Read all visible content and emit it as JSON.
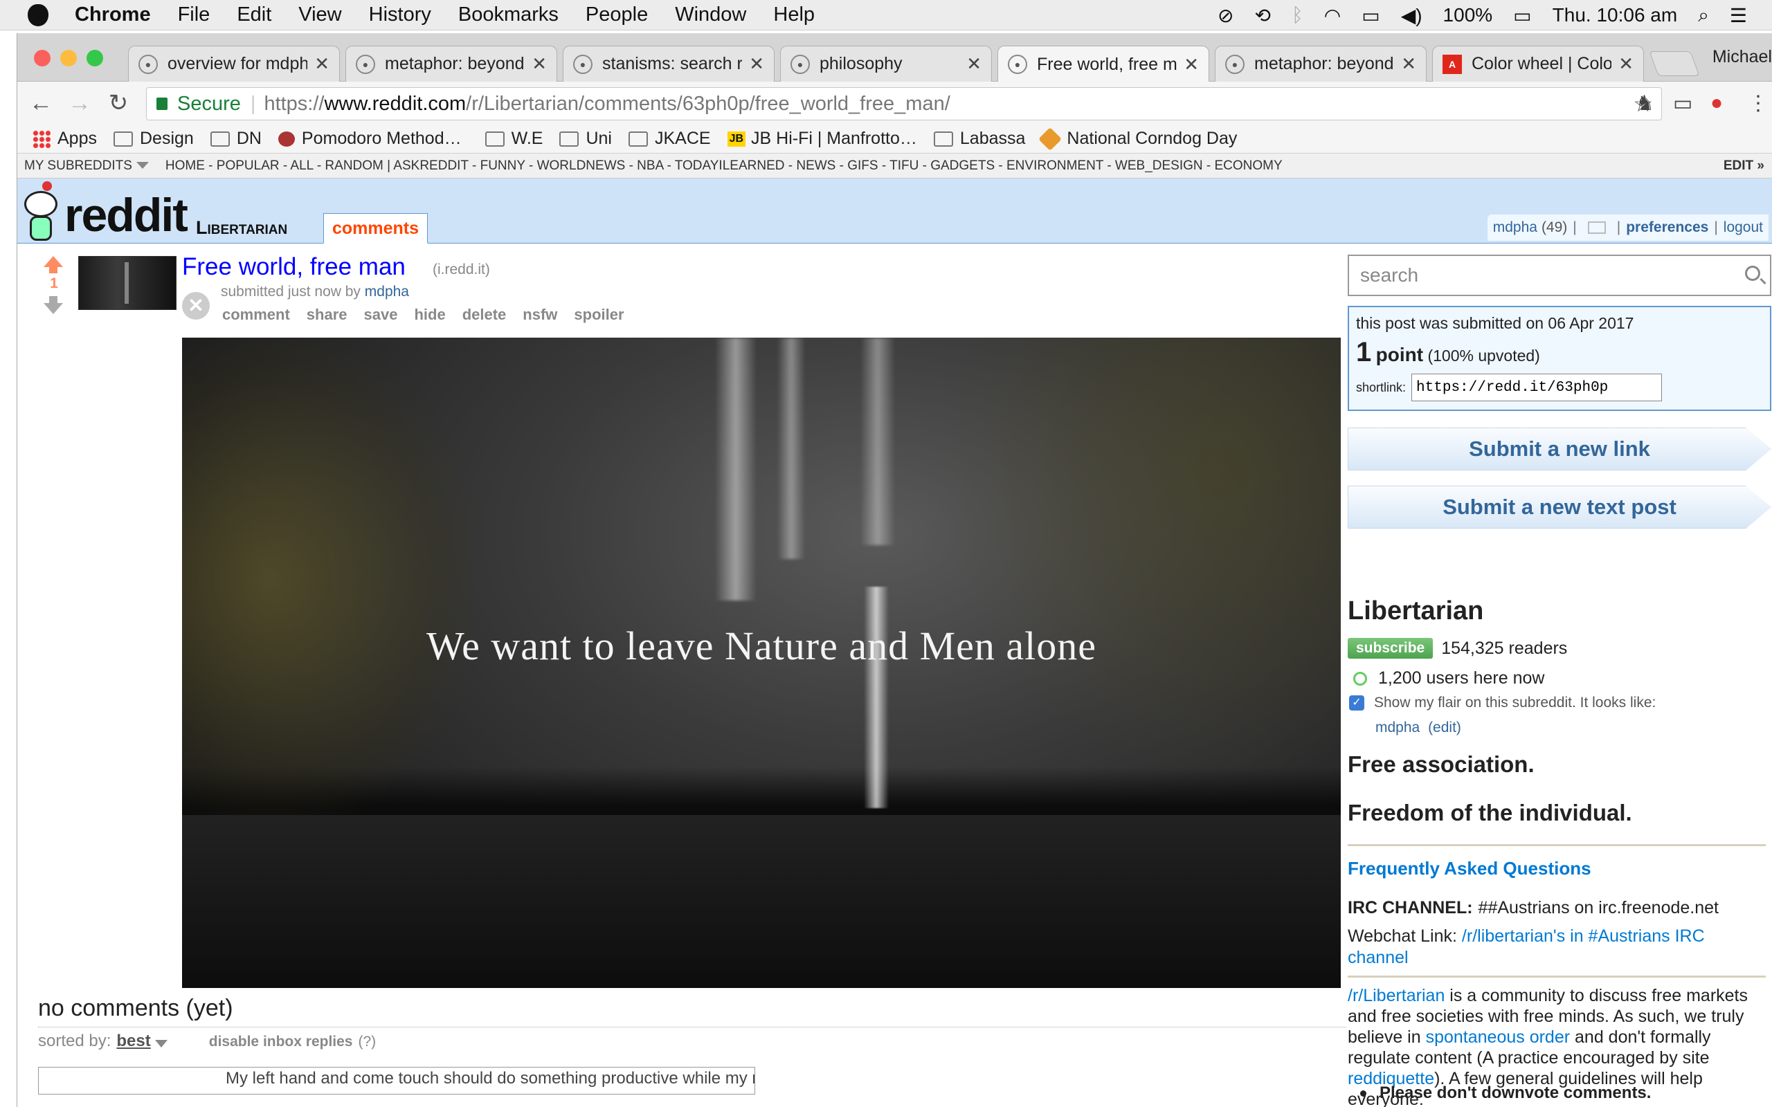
{
  "menubar": {
    "app": "Chrome",
    "items": [
      "File",
      "Edit",
      "View",
      "History",
      "Bookmarks",
      "People",
      "Window",
      "Help"
    ],
    "battery": "100%",
    "clock": "Thu. 10:06 am"
  },
  "tabs": [
    {
      "title": "overview for mdph",
      "active": false
    },
    {
      "title": "metaphor: beyond",
      "active": false
    },
    {
      "title": "stanisms: search r",
      "active": false
    },
    {
      "title": "philosophy",
      "active": false
    },
    {
      "title": "Free world, free m",
      "active": true
    },
    {
      "title": "metaphor: beyond",
      "active": false
    },
    {
      "title": "Color wheel | Colo",
      "active": false
    }
  ],
  "profile_name": "Michael",
  "omnibox": {
    "secure_label": "Secure",
    "url_scheme": "https://",
    "url_host": "www.reddit.com",
    "url_path": "/r/Libertarian/comments/63ph0p/free_world_free_man/"
  },
  "bookmarks": [
    "Apps",
    "Design",
    "DN",
    "Pomodoro Method…",
    "W.E",
    "Uni",
    "JKACE",
    "JB Hi-Fi | Manfrotto…",
    "Labassa",
    "National Corndog Day"
  ],
  "srbar": {
    "my_subreddits": "MY SUBREDDITS",
    "links": "HOME - POPULAR - ALL - RANDOM  |  ASKREDDIT - FUNNY - WORLDNEWS - NBA - TODAYILEARNED - NEWS - GIFS - TIFU - GADGETS - ENVIRONMENT - WEB_DESIGN - ECONOMY",
    "edit": "EDIT »"
  },
  "header": {
    "logo": "reddit",
    "subreddit": "Libertarian",
    "tab": "comments",
    "user": "mdpha",
    "karma": "(49)",
    "preferences": "preferences",
    "logout": "logout"
  },
  "post": {
    "score": "1",
    "title": "Free world, free man",
    "domain": "(i.redd.it)",
    "submitted": "submitted just now by",
    "author": "mdpha",
    "buttons": [
      "comment",
      "share",
      "save",
      "hide",
      "delete",
      "nsfw",
      "spoiler"
    ],
    "image_text": "We want to leave Nature and Men alone"
  },
  "comments": {
    "header": "no comments (yet)",
    "sorted_by": "sorted by:",
    "sort_value": "best",
    "disable": "disable inbox replies",
    "help": "(?)",
    "box_text": "My left hand and come touch should do something productive while my right hand"
  },
  "sidebar": {
    "search_placeholder": "search",
    "submitted_on": "this post was submitted on 06 Apr 2017",
    "points_num": "1",
    "points_word": "point",
    "upvoted": "(100% upvoted)",
    "shortlink_label": "shortlink:",
    "shortlink": "https://redd.it/63ph0p",
    "submit_link": "Submit a new link",
    "submit_text": "Submit a new text post",
    "sr_title": "Libertarian",
    "subscribe": "subscribe",
    "readers": "154,325 readers",
    "online": "1,200 users here now",
    "flair_text": "Show my flair on this subreddit. It looks like:",
    "flair_user": "mdpha",
    "flair_edit": "(edit)",
    "h1": "Free association.",
    "h2": "Freedom of the individual.",
    "faq": "Frequently Asked Questions",
    "irc_label": "IRC CHANNEL:",
    "irc_value": "##Austrians on irc.freenode.net",
    "webchat_label": "Webchat Link:",
    "webchat_link": "/r/libertarian's in #Austrians IRC channel",
    "desc_link": "/r/Libertarian",
    "desc_1": " is a community to discuss free markets and free societies with free minds. As such, we truly believe in ",
    "desc_link2": "spontaneous order",
    "desc_2": " and don't formally regulate content (A practice encouraged by site ",
    "desc_link3": "reddiquette",
    "desc_3": "). A few general guidelines will help everyone:",
    "rule1": "Please don't downvote comments."
  }
}
